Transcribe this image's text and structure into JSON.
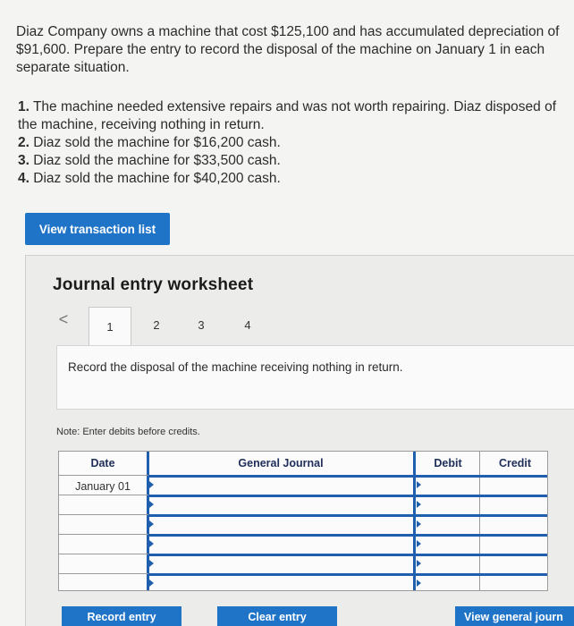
{
  "problem": {
    "intro": "Diaz Company owns a machine that cost $125,100 and has accumulated depreciation of $91,600. Prepare the entry to record the disposal of the machine on January 1 in each separate situation.",
    "requirements": [
      {
        "num": "1.",
        "text": "The machine needed extensive repairs and was not worth repairing. Diaz disposed of the machine, receiving nothing in return."
      },
      {
        "num": "2.",
        "text": "Diaz sold the machine for $16,200 cash."
      },
      {
        "num": "3.",
        "text": "Diaz sold the machine for $33,500 cash."
      },
      {
        "num": "4.",
        "text": "Diaz sold the machine for $40,200 cash."
      }
    ]
  },
  "view_transaction_list_label": "View transaction list",
  "worksheet": {
    "title": "Journal entry worksheet",
    "tabs": [
      "1",
      "2",
      "3",
      "4"
    ],
    "active_tab": "1",
    "prev_arrow": "<",
    "instruction": "Record the disposal of the machine receiving nothing in return.",
    "note": "Note: Enter debits before credits.",
    "table": {
      "headers": {
        "date": "Date",
        "journal": "General Journal",
        "debit": "Debit",
        "credit": "Credit"
      },
      "first_date": "January 01"
    },
    "buttons": {
      "record": "Record entry",
      "clear": "Clear entry",
      "view_journal": "View general journ"
    }
  }
}
